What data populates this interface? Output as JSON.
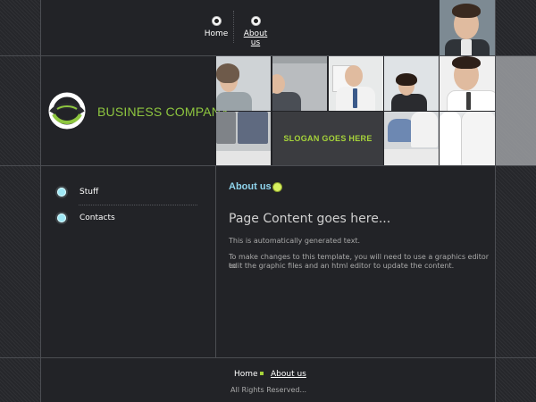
{
  "nav": {
    "home": "Home",
    "about": "About us"
  },
  "brand": {
    "company_name": "BUSINESS COMPANY",
    "slogan": "SLOGAN GOES HERE",
    "accent_color": "#8ec63f"
  },
  "sidebar": {
    "items": [
      {
        "label": "Stuff"
      },
      {
        "label": "Contacts"
      }
    ]
  },
  "main": {
    "section_title": "About us",
    "heading": "Page Content goes here...",
    "paragraph1": "This is automatically generated text.",
    "paragraph2_line1": "To make changes to this template, you will need to use a graphics editor to",
    "paragraph2_line2": "edit the graphic files and an html editor to update the content."
  },
  "footer": {
    "home": "Home",
    "about": "About us",
    "copyright": "All Rights Reserved..."
  }
}
